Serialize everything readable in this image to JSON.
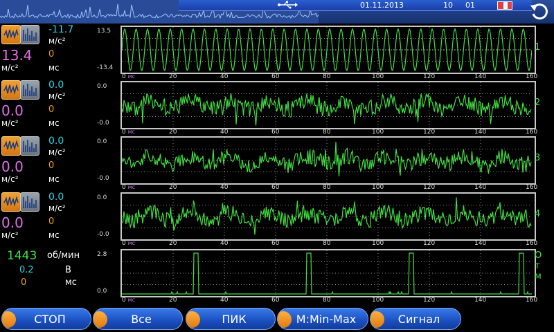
{
  "topbar": {
    "date": "01.11.2013",
    "time_h": "10",
    "time_m": "01",
    "icons": [
      "usb-icon",
      "battery-icon",
      "back-arrow-icon"
    ]
  },
  "channels": [
    {
      "id": "1",
      "value_top": "-11.7",
      "unit_top": "м/с²",
      "value_main": "13.4",
      "unit_main": "м/с²",
      "value_small": "0",
      "unit_small": "мс",
      "y_max": "13.5",
      "y_min": "-13.4"
    },
    {
      "id": "2",
      "value_top": "0.0",
      "unit_top": "м/с²",
      "value_main": "0.0",
      "unit_main": "м/с²",
      "value_small": "0",
      "unit_small": "мс",
      "y_max": "0.0",
      "y_min": "-0.0"
    },
    {
      "id": "3",
      "value_top": "0.0",
      "unit_top": "м/с²",
      "value_main": "0.0",
      "unit_main": "м/с²",
      "value_small": "0",
      "unit_small": "мс",
      "y_max": "0.0",
      "y_min": "-0.0"
    },
    {
      "id": "4",
      "value_top": "0.0",
      "unit_top": "м/с²",
      "value_main": "0.0",
      "unit_main": "м/с²",
      "value_small": "0",
      "unit_small": "мс",
      "y_max": "0.0",
      "y_min": "-0.0"
    }
  ],
  "tacho": {
    "rpm": "1443",
    "rpm_unit": "об/мин",
    "volt": "0.2",
    "volt_unit": "В",
    "ms": "0",
    "ms_unit": "мс",
    "y_max": "2.8",
    "y_min": "0.0",
    "label": "О\nт\nм"
  },
  "x_axis": {
    "first": "0",
    "unit": "мс",
    "ticks": [
      "20",
      "40",
      "60",
      "80",
      "100",
      "120",
      "140",
      "160"
    ]
  },
  "buttons": {
    "stop": "СТОП",
    "all": "Все",
    "peak": "ПИК",
    "minmax": "М:Min-Max",
    "signal": "Сигнал"
  },
  "colors": {
    "trace": "#40e040",
    "grid": "#c8c8c8",
    "accent_orange": "#e07a10",
    "button_blue": "#1a4fc0"
  },
  "chart_data": [
    {
      "type": "line",
      "series": [
        {
          "values": "sine"
        }
      ],
      "y_range": [
        -13.4,
        13.5
      ],
      "x_range": [
        0,
        160
      ]
    },
    {
      "type": "line",
      "series": [
        {
          "values": "noise"
        }
      ],
      "y_range": [
        -0.0,
        0.0
      ],
      "x_range": [
        0,
        160
      ]
    },
    {
      "type": "line",
      "series": [
        {
          "values": "noise"
        }
      ],
      "y_range": [
        -0.0,
        0.0
      ],
      "x_range": [
        0,
        160
      ]
    },
    {
      "type": "line",
      "series": [
        {
          "values": "noise"
        }
      ],
      "y_range": [
        -0.0,
        0.0
      ],
      "x_range": [
        0,
        160
      ]
    },
    {
      "type": "line",
      "pulses_x": [
        28,
        72,
        112,
        155
      ],
      "y_range": [
        0.0,
        2.8
      ],
      "x_range": [
        0,
        160
      ]
    }
  ]
}
